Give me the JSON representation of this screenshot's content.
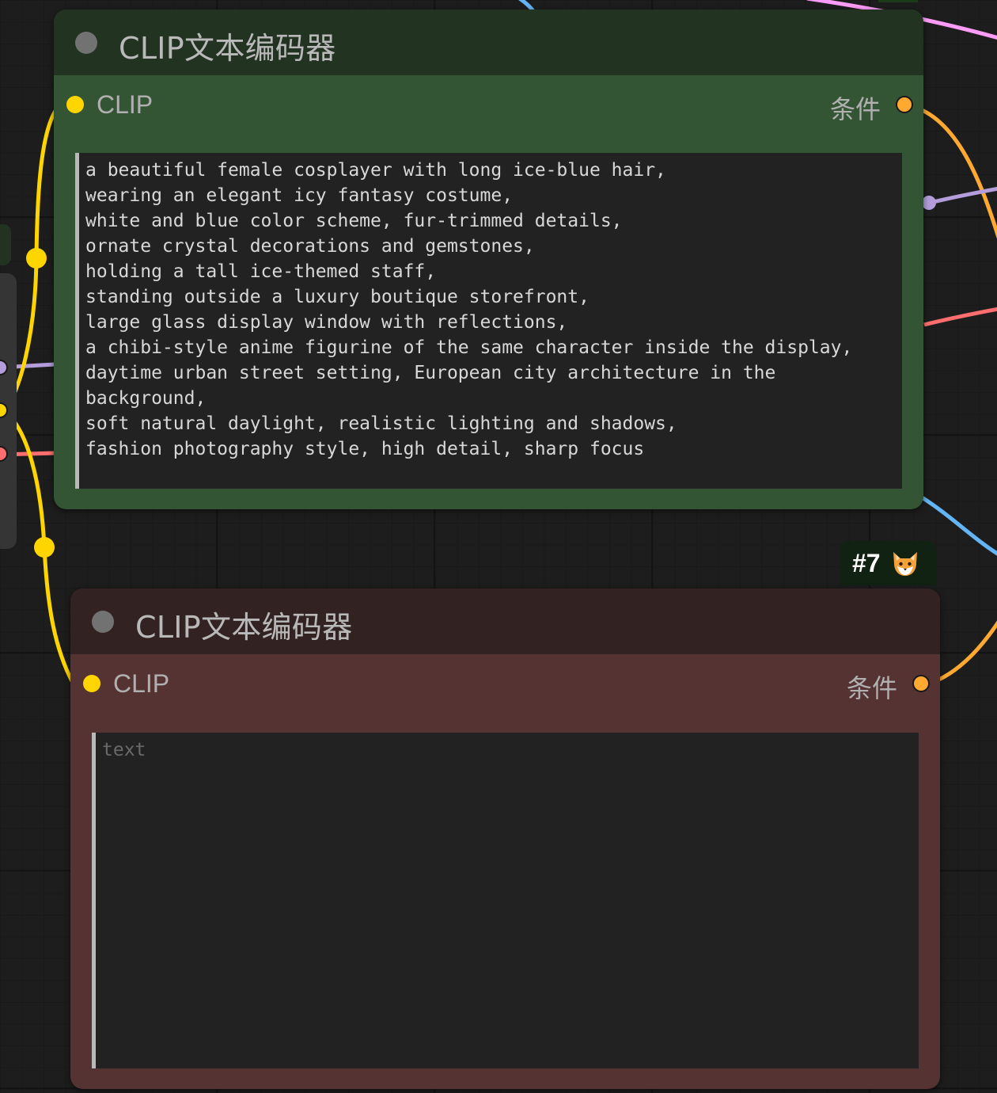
{
  "colors": {
    "canvas_bg": "#1d1d1d",
    "positive_node_header": "#223322",
    "positive_node_body": "#335533",
    "negative_node_header": "#332222",
    "negative_node_body": "#553333",
    "clip_wire": "#ffd500",
    "conditioning_wire": "#ffa931",
    "vae_wire": "#ff6e6e",
    "model_wire": "#b39ddb",
    "latent_wire": "#ff9cf9",
    "image_wire": "#64b5f6"
  },
  "nodes": [
    {
      "title": "CLIP文本编码器",
      "input_label": "CLIP",
      "output_label": "条件",
      "text_value": "a beautiful female cosplayer with long ice-blue hair,\nwearing an elegant icy fantasy costume,\nwhite and blue color scheme, fur-trimmed details,\nornate crystal decorations and gemstones,\nholding a tall ice-themed staff,\nstanding outside a luxury boutique storefront,\nlarge glass display window with reflections,\na chibi-style anime figurine of the same character inside the display,\ndaytime urban street setting, European city architecture in the\nbackground,\nsoft natural daylight, realistic lighting and shadows,\nfashion photography style, high detail, sharp focus",
      "text_placeholder": "text"
    },
    {
      "title": "CLIP文本编码器",
      "input_label": "CLIP",
      "output_label": "条件",
      "text_value": "",
      "text_placeholder": "text"
    }
  ],
  "badge": {
    "id": "#7",
    "icon": "fox-icon"
  }
}
